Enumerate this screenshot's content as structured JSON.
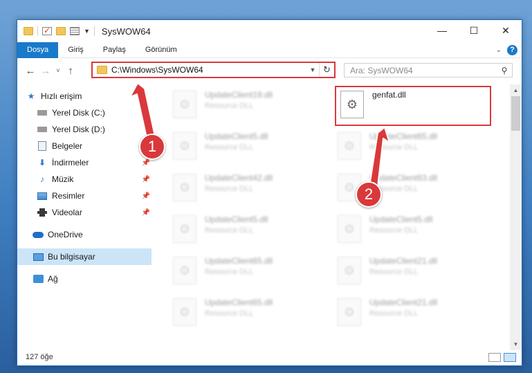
{
  "window": {
    "title": "SysWOW64",
    "caption": {
      "minimize": "—",
      "maximize": "☐",
      "close": "✕"
    }
  },
  "ribbon": {
    "tabs": [
      {
        "label": "Dosya",
        "active": true
      },
      {
        "label": "Giriş"
      },
      {
        "label": "Paylaş"
      },
      {
        "label": "Görünüm"
      }
    ],
    "help": "?"
  },
  "nav": {
    "back": "←",
    "forward": "→",
    "recent": "˅",
    "up": "↑",
    "address": "C:\\Windows\\SysWOW64",
    "refresh": "↻",
    "search_placeholder": "Ara: SysWOW64"
  },
  "sidebar": {
    "items": [
      {
        "label": "Hızlı erişim",
        "icon": "star-icon"
      },
      {
        "label": "Yerel Disk (C:)",
        "icon": "disk-icon"
      },
      {
        "label": "Yerel Disk (D:)",
        "icon": "disk-icon"
      },
      {
        "label": "Belgeler",
        "icon": "document-icon"
      },
      {
        "label": "İndirmeler",
        "icon": "download-icon"
      },
      {
        "label": "Müzik",
        "icon": "music-icon"
      },
      {
        "label": "Resimler",
        "icon": "pictures-icon"
      },
      {
        "label": "Videolar",
        "icon": "video-icon"
      },
      {
        "label": "OneDrive",
        "icon": "cloud-icon"
      },
      {
        "label": "Bu bilgisayar",
        "icon": "computer-icon",
        "selected": true
      },
      {
        "label": "Ağ",
        "icon": "network-icon"
      }
    ]
  },
  "files": [
    {
      "name": "UpdateClient19.dll",
      "type": "Resource DLL"
    },
    {
      "name": "genfat.dll",
      "type": ""
    },
    {
      "name": "UpdateClient5.dll",
      "type": "Resource DLL"
    },
    {
      "name": "UpdateClient65.dll",
      "type": "Resource DLL"
    },
    {
      "name": "UpdateClient42.dll",
      "type": "Resource DLL"
    },
    {
      "name": "UpdateClient63.dll",
      "type": "Resource DLL"
    },
    {
      "name": "UpdateClient5.dll",
      "type": "Resource DLL"
    },
    {
      "name": "UpdateClient5.dll",
      "type": "Resource DLL"
    },
    {
      "name": "UpdateClient65.dll",
      "type": "Resource DLL"
    },
    {
      "name": "UpdateClient21.dll",
      "type": "Resource DLL"
    },
    {
      "name": "UpdateClient65.dll",
      "type": "Resource DLL"
    },
    {
      "name": "UpdateClient21.dll",
      "type": "Resource DLL"
    }
  ],
  "status": {
    "count": "127 öğe"
  },
  "annotations": {
    "step1": "1",
    "step2": "2"
  },
  "colors": {
    "accent": "#1979ca",
    "highlight": "#d9393b",
    "selected": "#cce4f7"
  }
}
